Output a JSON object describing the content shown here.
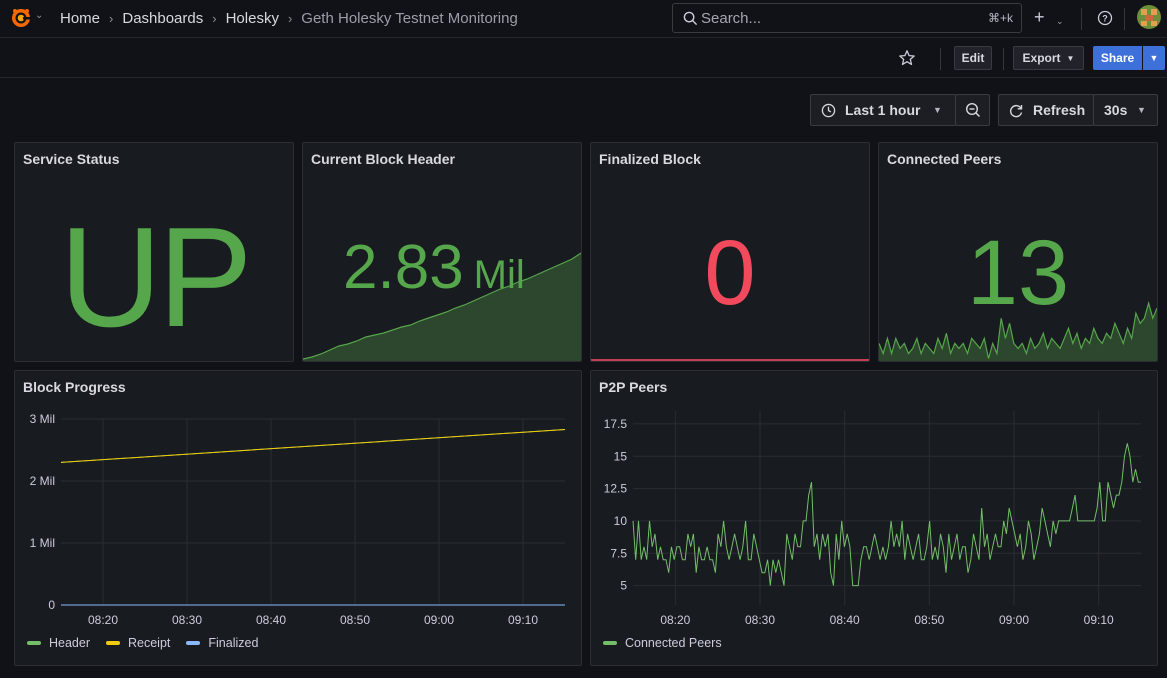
{
  "breadcrumbs": [
    {
      "label": "Home"
    },
    {
      "label": "Dashboards"
    },
    {
      "label": "Holesky"
    },
    {
      "label": "Geth Holesky Testnet Monitoring"
    }
  ],
  "search": {
    "placeholder": "Search...",
    "shortcut": "⌘+k"
  },
  "toolbar": {
    "edit_label": "Edit",
    "export_label": "Export",
    "share_label": "Share"
  },
  "time": {
    "range_label": "Last 1 hour",
    "refresh_label": "Refresh",
    "interval_label": "30s"
  },
  "colors": {
    "green": "#73bf69",
    "stat_green": "#56a64b",
    "red": "#f2495c",
    "yellow": "#f2cc0c",
    "blue": "#8ab8ff",
    "share_blue": "#3d71d9"
  },
  "panels": {
    "service_status": {
      "title": "Service Status",
      "value": "UP",
      "color": "#56a64b"
    },
    "current_block": {
      "title": "Current Block Header",
      "value": "2.83",
      "unit": "Mil",
      "color": "#56a64b"
    },
    "finalized": {
      "title": "Finalized Block",
      "value": "0",
      "color": "#f2495c"
    },
    "peers": {
      "title": "Connected Peers",
      "value": "13",
      "color": "#56a64b"
    },
    "block_progress": {
      "title": "Block Progress"
    },
    "p2p_peers": {
      "title": "P2P Peers"
    }
  },
  "chart_data": [
    {
      "type": "line",
      "title": "Block Progress",
      "x_ticks": [
        "08:20",
        "08:30",
        "08:40",
        "08:50",
        "09:00",
        "09:10"
      ],
      "y_ticks": [
        "0",
        "1 Mil",
        "2 Mil",
        "3 Mil"
      ],
      "ylim": [
        0,
        3000000
      ],
      "x_range": [
        "08:15",
        "09:15"
      ],
      "grid": true,
      "legend_placement": "bottom-left",
      "series": [
        {
          "name": "Header",
          "color": "#73bf69",
          "x": [
            "08:15",
            "09:15"
          ],
          "values": [
            2300000,
            2830000
          ]
        },
        {
          "name": "Receipt",
          "color": "#f2cc0c",
          "x": [
            "08:15",
            "09:15"
          ],
          "values": [
            2300000,
            2830000
          ]
        },
        {
          "name": "Finalized",
          "color": "#8ab8ff",
          "x": [
            "08:15",
            "09:15"
          ],
          "values": [
            0,
            0
          ]
        }
      ]
    },
    {
      "type": "line",
      "title": "P2P Peers",
      "x_ticks": [
        "08:20",
        "08:30",
        "08:40",
        "08:50",
        "09:00",
        "09:10"
      ],
      "y_ticks": [
        "5",
        "7.5",
        "10",
        "12.5",
        "15",
        "17.5"
      ],
      "ylim": [
        3.5,
        18.5
      ],
      "x_range": [
        "08:15",
        "09:15"
      ],
      "grid": true,
      "legend_placement": "bottom-left",
      "series": [
        {
          "name": "Connected Peers",
          "color": "#73bf69",
          "values": [
            10,
            7,
            10,
            7,
            8,
            7,
            10,
            8,
            9,
            7,
            8,
            7,
            7,
            6,
            8,
            7,
            8,
            8,
            7,
            7,
            9,
            8,
            9,
            6,
            8,
            7,
            7,
            8,
            7,
            7,
            6,
            9,
            8,
            10,
            8,
            7,
            8,
            9,
            8,
            7,
            8,
            10,
            7,
            7,
            9,
            8,
            7,
            6,
            6,
            7,
            5,
            7,
            6,
            7,
            6,
            5,
            9,
            8,
            7,
            9,
            8,
            8,
            10,
            10,
            12,
            13,
            8,
            9,
            7,
            9,
            8,
            9,
            6,
            5,
            9,
            7,
            10,
            8,
            9,
            8,
            5,
            5,
            5,
            7,
            8,
            8,
            7,
            8,
            9,
            8,
            7,
            8,
            7,
            8,
            10,
            8,
            9,
            8,
            10,
            7,
            9,
            8,
            7,
            8,
            9,
            7,
            7,
            8,
            10,
            7,
            8,
            7,
            9,
            8,
            6,
            9,
            7,
            8,
            9,
            7,
            8,
            8,
            6,
            7,
            9,
            8,
            7,
            11,
            8,
            9,
            7,
            8,
            9,
            8,
            8,
            10,
            9,
            11,
            10,
            9,
            8,
            9,
            7,
            8,
            10,
            9,
            7,
            8,
            9,
            11,
            10,
            9,
            8,
            10,
            9,
            10,
            10,
            10,
            10,
            10,
            11,
            12,
            10,
            10,
            10,
            10,
            10,
            10,
            10,
            11,
            13,
            10,
            10,
            13,
            12,
            11,
            12,
            12,
            13,
            15,
            16,
            15,
            13,
            14,
            13,
            13
          ]
        }
      ]
    },
    {
      "type": "area",
      "title": "Current Block Header",
      "ylim": [
        2290000,
        2840000
      ],
      "series": [
        {
          "name": "Header",
          "color": "#56a64b",
          "values": [
            2300000,
            2310000,
            2325000,
            2345000,
            2365000,
            2375000,
            2390000,
            2410000,
            2420000,
            2430000,
            2445000,
            2460000,
            2470000,
            2490000,
            2505000,
            2520000,
            2535000,
            2555000,
            2570000,
            2590000,
            2610000,
            2630000,
            2650000,
            2665000,
            2685000,
            2700000,
            2720000,
            2740000,
            2760000,
            2780000,
            2800000,
            2830000
          ]
        }
      ]
    },
    {
      "type": "area",
      "title": "Connected Peers",
      "ylim": [
        4.5,
        20
      ],
      "series": [
        {
          "name": "Connected Peers",
          "color": "#56a64b",
          "values": [
            8,
            6,
            9,
            6,
            9,
            7,
            8,
            6,
            7,
            9,
            6,
            8,
            7,
            6,
            9,
            7,
            10,
            6,
            8,
            7,
            8,
            6,
            9,
            8,
            7,
            9,
            5,
            8,
            6,
            13,
            9,
            12,
            8,
            7,
            8,
            6,
            9,
            7,
            8,
            10,
            7,
            9,
            8,
            7,
            9,
            11,
            8,
            10,
            7,
            9,
            8,
            11,
            9,
            8,
            10,
            9,
            12,
            10,
            8,
            11,
            9,
            14,
            12,
            13,
            16,
            13,
            15
          ]
        }
      ]
    }
  ]
}
